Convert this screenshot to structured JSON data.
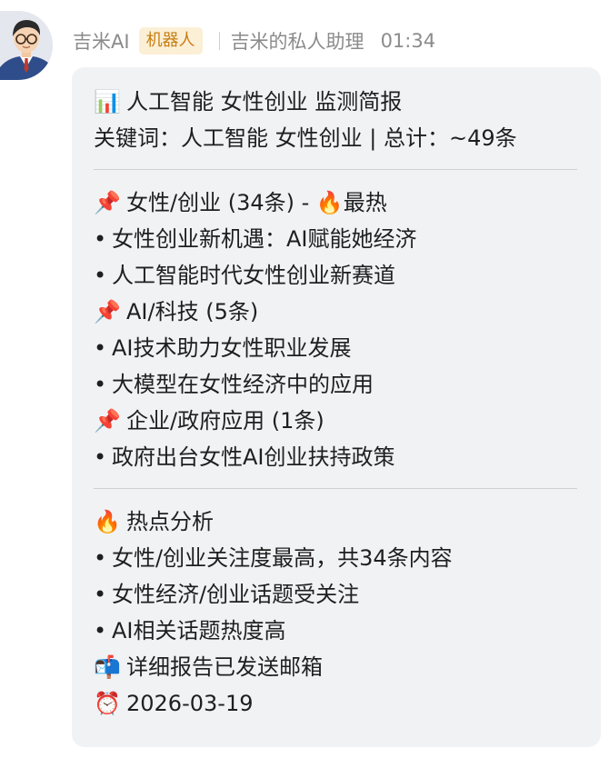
{
  "header": {
    "sender_name": "吉米AI",
    "bot_badge": "机器人",
    "bot_description": "吉米的私人助理",
    "time": "01:34"
  },
  "message": {
    "title_icon": "📊",
    "title": "人工智能 女性创业 监测简报",
    "keywords_line": "关键词：人工智能 女性创业 | 总计：~49条",
    "sections": [
      {
        "icon": "📌",
        "title": "女性/创业 (34条) - 🔥最热",
        "items": [
          "女性创业新机遇：AI赋能她经济",
          "人工智能时代女性创业新赛道"
        ]
      },
      {
        "icon": "📌",
        "title": "AI/科技 (5条)",
        "items": [
          "AI技术助力女性职业发展",
          "大模型在女性经济中的应用"
        ]
      },
      {
        "icon": "📌",
        "title": "企业/政府应用 (1条)",
        "items": [
          "政府出台女性AI创业扶持政策"
        ]
      }
    ],
    "analysis": {
      "icon": "🔥",
      "title": "热点分析",
      "items": [
        "女性/创业关注度最高，共34条内容",
        "女性经济/创业话题受关注",
        "AI相关话题热度高"
      ]
    },
    "report_icon": "📬",
    "report_text": "详细报告已发送邮箱",
    "date_icon": "⏰",
    "date": "2026-03-19",
    "bullet": "•"
  }
}
